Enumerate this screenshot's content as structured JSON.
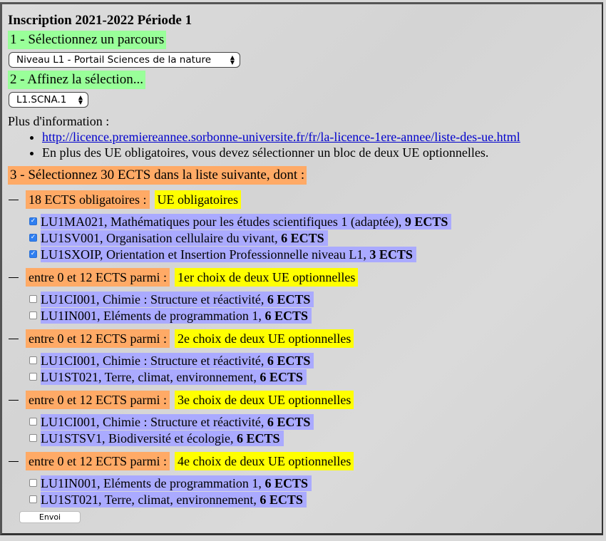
{
  "title": "Inscription 2021-2022 Période 1",
  "step1": {
    "label": "1 - Sélectionnez un parcours",
    "select_value": "Niveau L1 - Portail Sciences de la nature"
  },
  "step2": {
    "label": "2 - Affinez la sélection...",
    "select_value": "L1.SCNA.1"
  },
  "info": {
    "label": "Plus d'information :",
    "link": "http://licence.premiereannee.sorbonne-universite.fr/fr/la-licence-1ere-annee/liste-des-ue.html",
    "note": "En plus des UE obligatoires, vous devez sélectionner un bloc de deux UE optionnelles."
  },
  "step3": {
    "label": "3 - Sélectionnez 30 ECTS dans la liste suivante, dont :"
  },
  "groups": [
    {
      "requirement": "18 ECTS obligatoires :",
      "name": "UE obligatoires",
      "items": [
        {
          "text": "LU1MA021, Mathématiques pour les études scientifiques 1 (adaptée),",
          "ects": "9 ECTS",
          "checked": true
        },
        {
          "text": "LU1SV001, Organisation cellulaire du vivant,",
          "ects": "6 ECTS",
          "checked": true
        },
        {
          "text": "LU1SXOIP, Orientation et Insertion Professionnelle niveau L1,",
          "ects": "3 ECTS",
          "checked": true
        }
      ]
    },
    {
      "requirement": "entre 0 et 12 ECTS parmi :",
      "name": "1er choix de deux UE optionnelles",
      "items": [
        {
          "text": "LU1CI001, Chimie : Structure et réactivité,",
          "ects": "6 ECTS",
          "checked": false
        },
        {
          "text": "LU1IN001, Eléments de programmation 1,",
          "ects": "6 ECTS",
          "checked": false
        }
      ]
    },
    {
      "requirement": "entre 0 et 12 ECTS parmi :",
      "name": "2e choix de deux UE optionnelles",
      "items": [
        {
          "text": "LU1CI001, Chimie : Structure et réactivité,",
          "ects": "6 ECTS",
          "checked": false
        },
        {
          "text": "LU1ST021, Terre, climat, environnement,",
          "ects": "6 ECTS",
          "checked": false
        }
      ]
    },
    {
      "requirement": "entre 0 et 12 ECTS parmi :",
      "name": "3e choix de deux UE optionnelles",
      "items": [
        {
          "text": "LU1CI001, Chimie : Structure et réactivité,",
          "ects": "6 ECTS",
          "checked": false
        },
        {
          "text": "LU1STSV1, Biodiversité et écologie,",
          "ects": "6 ECTS",
          "checked": false
        }
      ]
    },
    {
      "requirement": "entre 0 et 12 ECTS parmi :",
      "name": "4e choix de deux UE optionnelles",
      "items": [
        {
          "text": "LU1IN001, Eléments de programmation 1,",
          "ects": "6 ECTS",
          "checked": false
        },
        {
          "text": "LU1ST021, Terre, climat, environnement,",
          "ects": "6 ECTS",
          "checked": false
        }
      ]
    }
  ],
  "submit_label": "Envoi"
}
